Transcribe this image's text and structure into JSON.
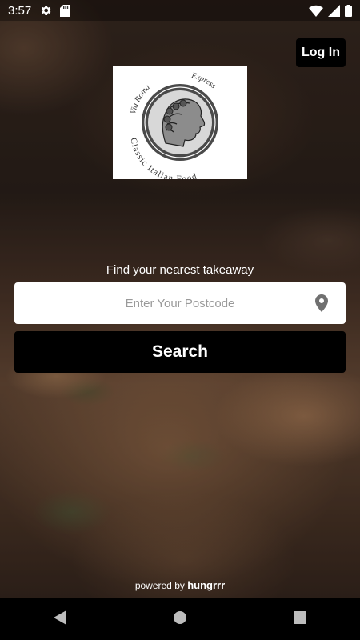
{
  "status_bar": {
    "time": "3:57",
    "icons": [
      "gear-icon",
      "sd-card-icon",
      "wifi-icon",
      "signal-icon",
      "battery-icon"
    ]
  },
  "header": {
    "login_label": "Log In"
  },
  "logo": {
    "text_left": "Via Roma",
    "text_right": "Express",
    "text_bottom": "Classic Italian Food"
  },
  "search": {
    "prompt": "Find your nearest takeaway",
    "placeholder": "Enter Your Postcode",
    "value": "",
    "button_label": "Search"
  },
  "footer": {
    "powered_prefix": "powered by",
    "powered_brand": "hungrrr"
  },
  "nav": {
    "icons": [
      "back-icon",
      "home-icon",
      "recents-icon"
    ]
  },
  "colors": {
    "button_bg": "#000000",
    "input_bg": "#ffffff",
    "placeholder": "#9a9a9a",
    "icon_gray": "#707070"
  }
}
